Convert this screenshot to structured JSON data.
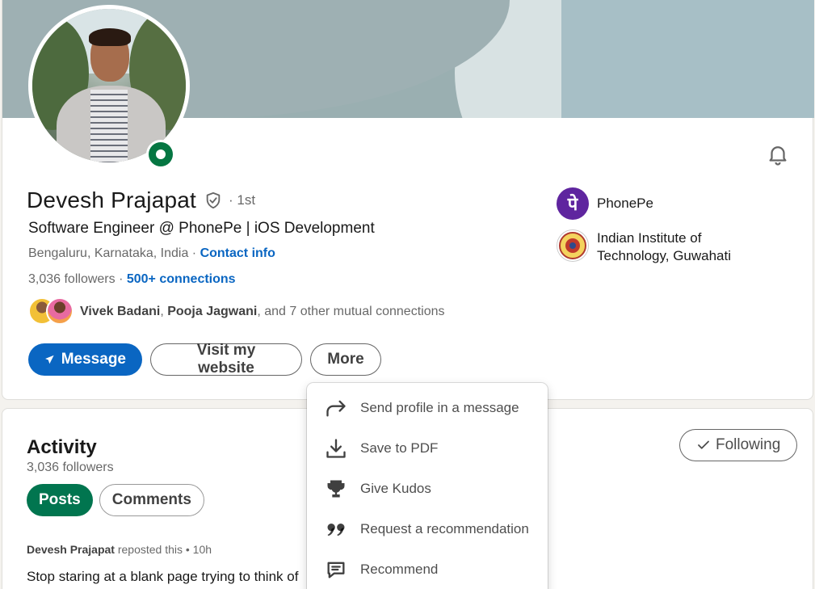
{
  "profile": {
    "name": "Devesh Prajapat",
    "degree": "· 1st",
    "headline": "Software Engineer @ PhonePe | iOS Development",
    "location": "Bengaluru, Karnataka, India",
    "location_sep": " · ",
    "contact_info": "Contact info",
    "followers": "3,036 followers",
    "followers_sep": " · ",
    "connections": "500+ connections",
    "mutual": {
      "person1": "Vivek Badani",
      "sep": ", ",
      "person2": "Pooja Jagwani",
      "rest": ", and 7 other mutual connections"
    }
  },
  "actions": {
    "message": "Message",
    "website": "Visit my website",
    "more": "More"
  },
  "orgs": [
    {
      "name": "PhonePe",
      "logo_text": "पे"
    },
    {
      "name": "Indian Institute of Technology, Guwahati"
    }
  ],
  "more_menu": [
    {
      "label": "Send profile in a message",
      "icon": "share-arrow-icon"
    },
    {
      "label": "Save to PDF",
      "icon": "download-icon"
    },
    {
      "label": "Give Kudos",
      "icon": "trophy-icon"
    },
    {
      "label": "Request a recommendation",
      "icon": "quote-icon"
    },
    {
      "label": "Recommend",
      "icon": "chat-bubble-icon"
    }
  ],
  "activity": {
    "title": "Activity",
    "followers": "3,036 followers",
    "following_label": "Following",
    "tabs": [
      "Posts",
      "Comments"
    ],
    "post": {
      "author": "Devesh Prajapat",
      "meta": " reposted this • 10h",
      "text": "Stop staring at a blank page trying to think of"
    }
  },
  "colors": {
    "primary": "#0a66c2",
    "online": "#057642",
    "tab_active": "#01754f",
    "phonepe": "#5f259f"
  }
}
